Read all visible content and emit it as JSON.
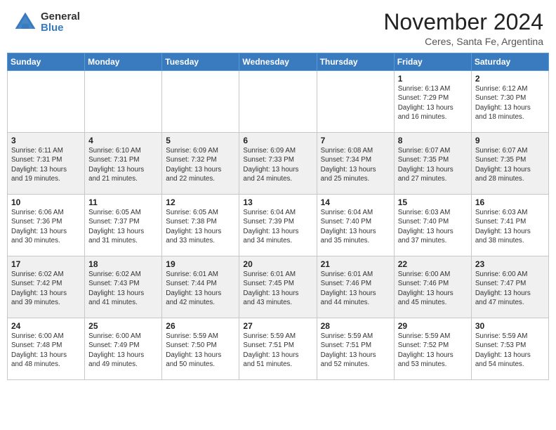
{
  "header": {
    "logo_general": "General",
    "logo_blue": "Blue",
    "month_title": "November 2024",
    "location": "Ceres, Santa Fe, Argentina"
  },
  "calendar": {
    "days_of_week": [
      "Sunday",
      "Monday",
      "Tuesday",
      "Wednesday",
      "Thursday",
      "Friday",
      "Saturday"
    ],
    "weeks": [
      [
        {
          "day": "",
          "info": ""
        },
        {
          "day": "",
          "info": ""
        },
        {
          "day": "",
          "info": ""
        },
        {
          "day": "",
          "info": ""
        },
        {
          "day": "",
          "info": ""
        },
        {
          "day": "1",
          "info": "Sunrise: 6:13 AM\nSunset: 7:29 PM\nDaylight: 13 hours\nand 16 minutes."
        },
        {
          "day": "2",
          "info": "Sunrise: 6:12 AM\nSunset: 7:30 PM\nDaylight: 13 hours\nand 18 minutes."
        }
      ],
      [
        {
          "day": "3",
          "info": "Sunrise: 6:11 AM\nSunset: 7:31 PM\nDaylight: 13 hours\nand 19 minutes."
        },
        {
          "day": "4",
          "info": "Sunrise: 6:10 AM\nSunset: 7:31 PM\nDaylight: 13 hours\nand 21 minutes."
        },
        {
          "day": "5",
          "info": "Sunrise: 6:09 AM\nSunset: 7:32 PM\nDaylight: 13 hours\nand 22 minutes."
        },
        {
          "day": "6",
          "info": "Sunrise: 6:09 AM\nSunset: 7:33 PM\nDaylight: 13 hours\nand 24 minutes."
        },
        {
          "day": "7",
          "info": "Sunrise: 6:08 AM\nSunset: 7:34 PM\nDaylight: 13 hours\nand 25 minutes."
        },
        {
          "day": "8",
          "info": "Sunrise: 6:07 AM\nSunset: 7:35 PM\nDaylight: 13 hours\nand 27 minutes."
        },
        {
          "day": "9",
          "info": "Sunrise: 6:07 AM\nSunset: 7:35 PM\nDaylight: 13 hours\nand 28 minutes."
        }
      ],
      [
        {
          "day": "10",
          "info": "Sunrise: 6:06 AM\nSunset: 7:36 PM\nDaylight: 13 hours\nand 30 minutes."
        },
        {
          "day": "11",
          "info": "Sunrise: 6:05 AM\nSunset: 7:37 PM\nDaylight: 13 hours\nand 31 minutes."
        },
        {
          "day": "12",
          "info": "Sunrise: 6:05 AM\nSunset: 7:38 PM\nDaylight: 13 hours\nand 33 minutes."
        },
        {
          "day": "13",
          "info": "Sunrise: 6:04 AM\nSunset: 7:39 PM\nDaylight: 13 hours\nand 34 minutes."
        },
        {
          "day": "14",
          "info": "Sunrise: 6:04 AM\nSunset: 7:40 PM\nDaylight: 13 hours\nand 35 minutes."
        },
        {
          "day": "15",
          "info": "Sunrise: 6:03 AM\nSunset: 7:40 PM\nDaylight: 13 hours\nand 37 minutes."
        },
        {
          "day": "16",
          "info": "Sunrise: 6:03 AM\nSunset: 7:41 PM\nDaylight: 13 hours\nand 38 minutes."
        }
      ],
      [
        {
          "day": "17",
          "info": "Sunrise: 6:02 AM\nSunset: 7:42 PM\nDaylight: 13 hours\nand 39 minutes."
        },
        {
          "day": "18",
          "info": "Sunrise: 6:02 AM\nSunset: 7:43 PM\nDaylight: 13 hours\nand 41 minutes."
        },
        {
          "day": "19",
          "info": "Sunrise: 6:01 AM\nSunset: 7:44 PM\nDaylight: 13 hours\nand 42 minutes."
        },
        {
          "day": "20",
          "info": "Sunrise: 6:01 AM\nSunset: 7:45 PM\nDaylight: 13 hours\nand 43 minutes."
        },
        {
          "day": "21",
          "info": "Sunrise: 6:01 AM\nSunset: 7:46 PM\nDaylight: 13 hours\nand 44 minutes."
        },
        {
          "day": "22",
          "info": "Sunrise: 6:00 AM\nSunset: 7:46 PM\nDaylight: 13 hours\nand 45 minutes."
        },
        {
          "day": "23",
          "info": "Sunrise: 6:00 AM\nSunset: 7:47 PM\nDaylight: 13 hours\nand 47 minutes."
        }
      ],
      [
        {
          "day": "24",
          "info": "Sunrise: 6:00 AM\nSunset: 7:48 PM\nDaylight: 13 hours\nand 48 minutes."
        },
        {
          "day": "25",
          "info": "Sunrise: 6:00 AM\nSunset: 7:49 PM\nDaylight: 13 hours\nand 49 minutes."
        },
        {
          "day": "26",
          "info": "Sunrise: 5:59 AM\nSunset: 7:50 PM\nDaylight: 13 hours\nand 50 minutes."
        },
        {
          "day": "27",
          "info": "Sunrise: 5:59 AM\nSunset: 7:51 PM\nDaylight: 13 hours\nand 51 minutes."
        },
        {
          "day": "28",
          "info": "Sunrise: 5:59 AM\nSunset: 7:51 PM\nDaylight: 13 hours\nand 52 minutes."
        },
        {
          "day": "29",
          "info": "Sunrise: 5:59 AM\nSunset: 7:52 PM\nDaylight: 13 hours\nand 53 minutes."
        },
        {
          "day": "30",
          "info": "Sunrise: 5:59 AM\nSunset: 7:53 PM\nDaylight: 13 hours\nand 54 minutes."
        }
      ]
    ]
  }
}
